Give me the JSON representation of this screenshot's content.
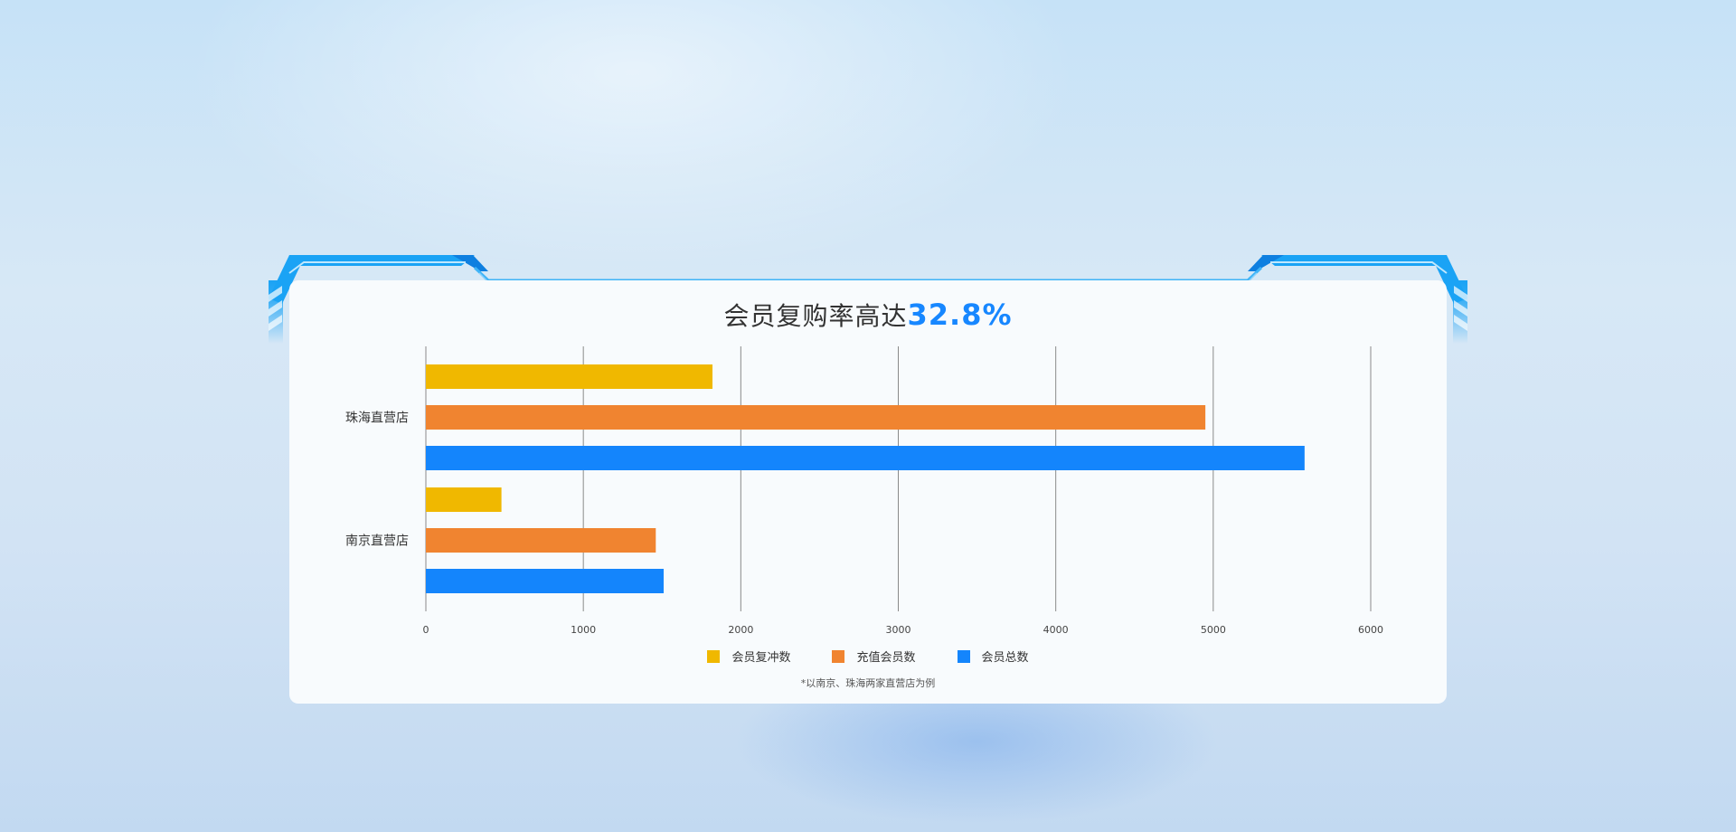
{
  "title": {
    "prefix": "会员复购率高达",
    "highlight": "32.8%"
  },
  "colors": {
    "accent": "#1787ff",
    "frame": "#1aa3f5",
    "yellow": "#f0b800",
    "orange": "#f08430",
    "blue": "#1485fc"
  },
  "chart_data": {
    "type": "bar",
    "orientation": "horizontal",
    "categories": [
      "珠海直营店",
      "南京直营店"
    ],
    "series": [
      {
        "name": "会员复冲数",
        "color": "#f0b800",
        "values": [
          1820,
          480
        ]
      },
      {
        "name": "充值会员数",
        "color": "#f08430",
        "values": [
          4950,
          1460
        ]
      },
      {
        "name": "会员总数",
        "color": "#1485fc",
        "values": [
          5580,
          1510
        ]
      }
    ],
    "xlim": [
      0,
      6000
    ],
    "xticks": [
      "0",
      "1000",
      "2000",
      "3000",
      "4000",
      "5000",
      "6000"
    ],
    "grid": true,
    "legend_position": "bottom"
  },
  "footnote": "*以南京、珠海两家直营店为例"
}
